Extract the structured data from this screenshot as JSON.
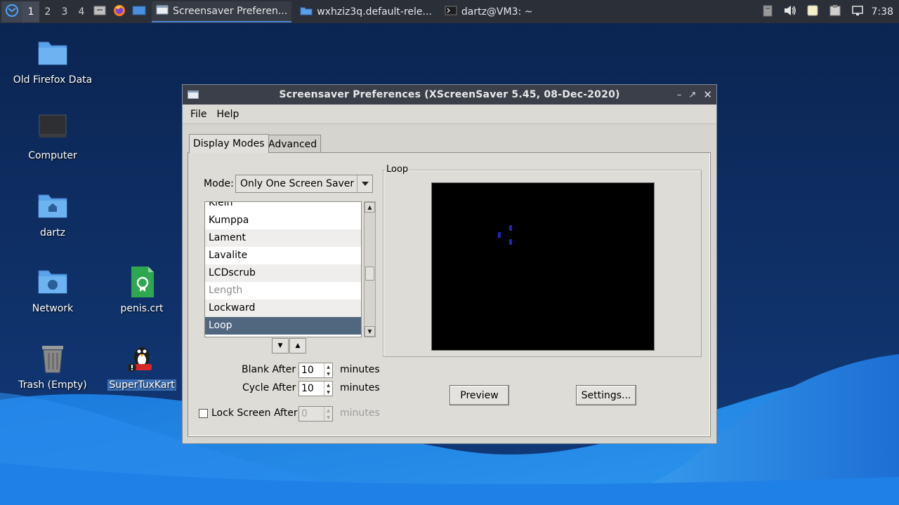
{
  "taskbar": {
    "workspaces": [
      "1",
      "2",
      "3",
      "4"
    ],
    "tasks": [
      {
        "label": "Screensaver Preferen...",
        "icon": "window-icon"
      },
      {
        "label": "wxhziz3q.default-rele...",
        "icon": "folder-icon"
      },
      {
        "label": "dartz@VM3: ~",
        "icon": "terminal-icon"
      }
    ],
    "clock": "7:38"
  },
  "desktop": {
    "icons": [
      {
        "label": "Old Firefox Data"
      },
      {
        "label": "Computer"
      },
      {
        "label": "dartz"
      },
      {
        "label": "Network"
      },
      {
        "label": "penis.crt"
      },
      {
        "label": "Trash (Empty)"
      },
      {
        "label": "SuperTuxKart"
      }
    ]
  },
  "window": {
    "title": "Screensaver Preferences  (XScreenSaver 5.45, 08-Dec-2020)",
    "menu": {
      "file": "File",
      "help": "Help"
    },
    "tabs": {
      "display_modes": "Display Modes",
      "advanced": "Advanced"
    },
    "mode": {
      "label": "Mode:",
      "value": "Only One Screen Saver"
    },
    "list": {
      "items": [
        "Klein",
        "Kumppa",
        "Lament",
        "Lavalite",
        "LCDscrub",
        "Length",
        "Lockward",
        "Loop"
      ],
      "selected": "Loop"
    },
    "blank_after": {
      "label": "Blank After",
      "value": "10",
      "unit": "minutes"
    },
    "cycle_after": {
      "label": "Cycle After",
      "value": "10",
      "unit": "minutes"
    },
    "lock_screen_after": {
      "label": "Lock Screen After",
      "value": "0",
      "unit": "minutes"
    },
    "preview": {
      "legend": "Loop",
      "preview_button": "Preview",
      "settings_button": "Settings..."
    }
  }
}
